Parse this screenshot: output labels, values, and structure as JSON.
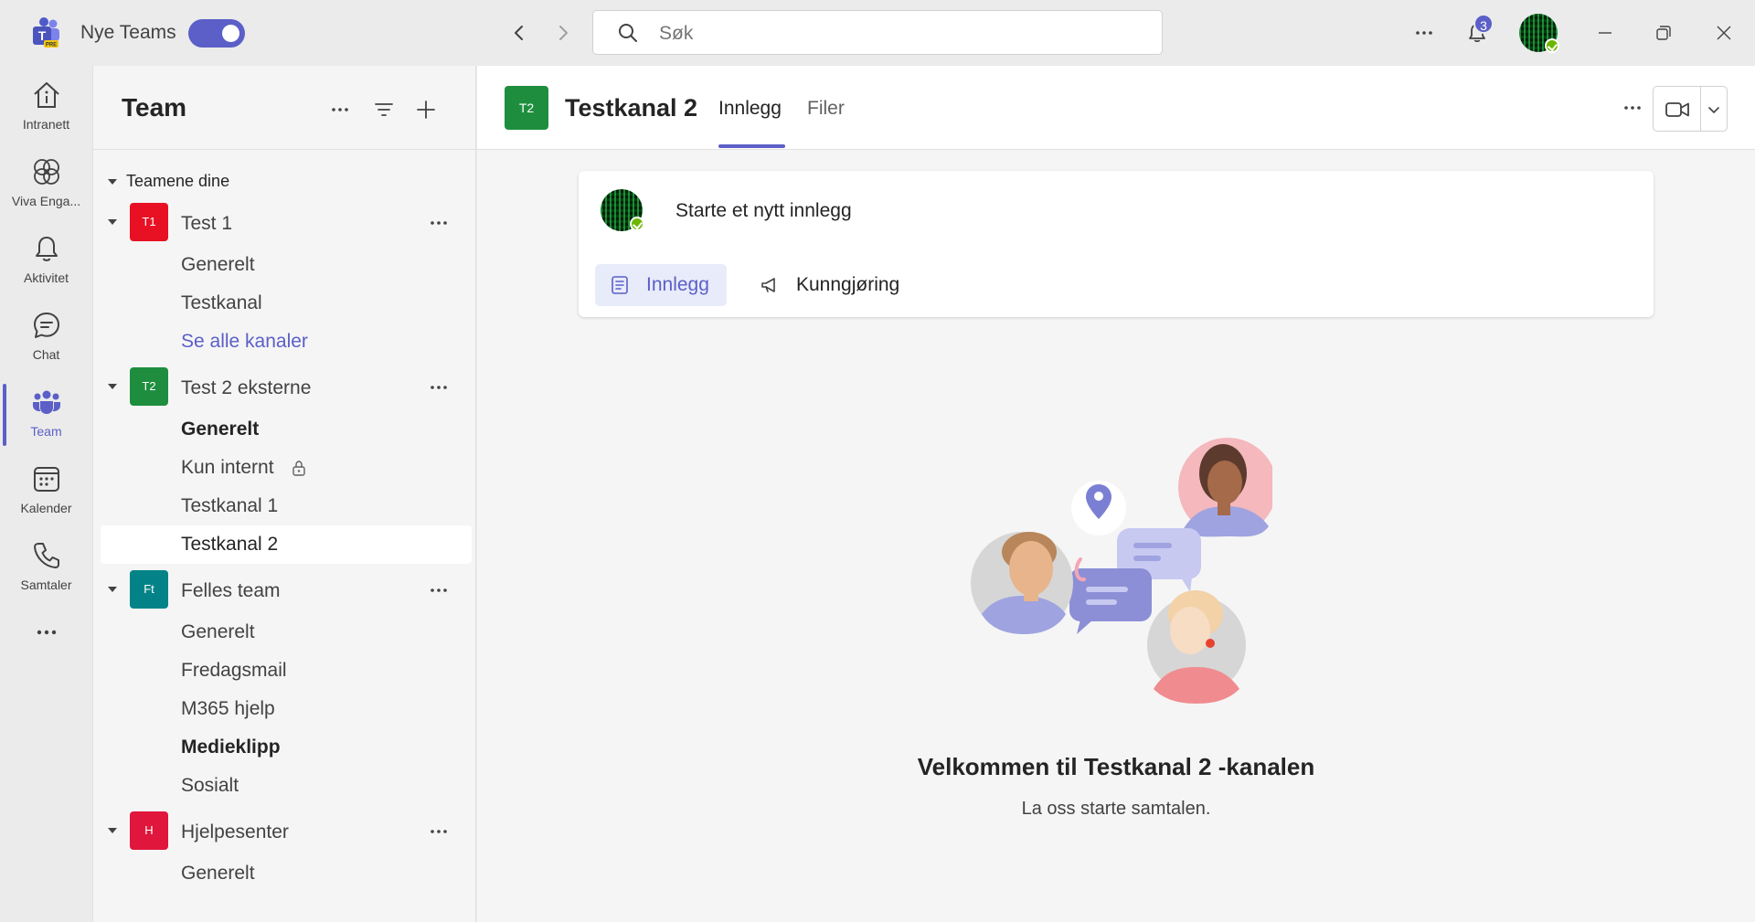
{
  "titlebar": {
    "app_name": "Nye Teams",
    "search_placeholder": "Søk",
    "notification_count": "3"
  },
  "rail": {
    "items": [
      {
        "label": "Intranett",
        "icon": "home-icon"
      },
      {
        "label": "Viva Enga...",
        "icon": "viva-engage-icon"
      },
      {
        "label": "Aktivitet",
        "icon": "bell-icon"
      },
      {
        "label": "Chat",
        "icon": "chat-icon"
      },
      {
        "label": "Team",
        "icon": "teams-icon"
      },
      {
        "label": "Kalender",
        "icon": "calendar-icon"
      },
      {
        "label": "Samtaler",
        "icon": "phone-icon"
      }
    ],
    "active": "Team"
  },
  "teampane": {
    "title": "Team",
    "section": "Teamene dine",
    "teams": [
      {
        "initials": "T1",
        "name": "Test 1",
        "color": "#e81123",
        "channels": [
          "Generelt",
          "Testkanal",
          "Se alle kanaler"
        ]
      },
      {
        "initials": "T2",
        "name": "Test 2 eksterne",
        "color": "#1e8e3e",
        "channels": [
          "Generelt",
          "Kun internt",
          "Testkanal 1",
          "Testkanal 2"
        ]
      },
      {
        "initials": "Ft",
        "name": "Felles team",
        "color": "#038387",
        "channels": [
          "Generelt",
          "Fredagsmail",
          "M365 hjelp",
          "Medieklipp",
          "Sosialt"
        ]
      },
      {
        "initials": "H",
        "name": "Hjelpesenter",
        "color": "#e0163c",
        "channels": [
          "Generelt"
        ]
      }
    ]
  },
  "channel": {
    "initials": "T2",
    "title": "Testkanal 2",
    "tabs": [
      "Innlegg",
      "Filer"
    ],
    "active_tab": "Innlegg",
    "compose_prompt": "Starte et nytt innlegg",
    "post_button": "Innlegg",
    "announcement_button": "Kunngjøring",
    "welcome_title": "Velkommen til Testkanal 2 -kanalen",
    "welcome_subtitle": "La oss starte samtalen."
  },
  "colors": {
    "accent": "#5b5fc7",
    "presence_available": "#6bb700"
  }
}
